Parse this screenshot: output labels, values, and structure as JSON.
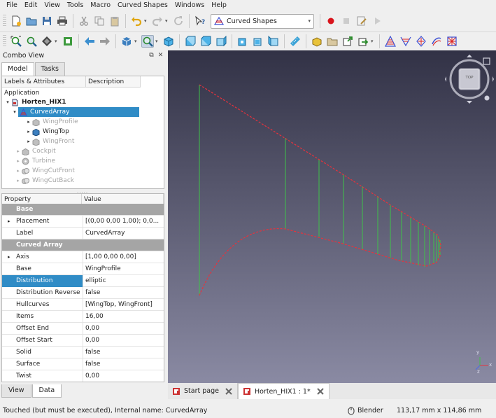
{
  "menu": [
    "File",
    "Edit",
    "View",
    "Tools",
    "Macro",
    "Curved Shapes",
    "Windows",
    "Help"
  ],
  "workbench": {
    "selected": "Curved Shapes"
  },
  "combo_view": {
    "title": "Combo View",
    "tabs": [
      "Model",
      "Tasks"
    ],
    "bottom_tabs": [
      "View",
      "Data"
    ]
  },
  "tree": {
    "headers": [
      "Labels & Attributes",
      "Description"
    ],
    "root": "Application",
    "items": [
      {
        "label": "Horten_HIX1",
        "bold": true,
        "icon": "document-icon"
      },
      {
        "label": "CurvedArray",
        "selected": true,
        "icon": "curved-array-icon"
      },
      {
        "label": "WingProfile",
        "dim": true,
        "icon": "part-icon"
      },
      {
        "label": "WingTop",
        "dim": false,
        "icon": "part-icon"
      },
      {
        "label": "WingFront",
        "dim": true,
        "icon": "part-icon"
      },
      {
        "label": "Cockpit",
        "dim": true,
        "icon": "part-icon"
      },
      {
        "label": "Turbine",
        "dim": true,
        "icon": "turbine-icon"
      },
      {
        "label": "WingCutFront",
        "dim": true,
        "icon": "cut-icon"
      },
      {
        "label": "WingCutBack",
        "dim": true,
        "icon": "cut-icon"
      }
    ]
  },
  "properties": {
    "headers": [
      "Property",
      "Value"
    ],
    "groups": [
      {
        "name": "Base"
      },
      {
        "name": "Curved Array"
      }
    ],
    "rows": [
      {
        "name": "Placement",
        "value": "[(0,00 0,00 1,00); 0,0..."
      },
      {
        "name": "Label",
        "value": "CurvedArray"
      },
      {
        "name": "Axis",
        "value": "[1,00 0,00 0,00]"
      },
      {
        "name": "Base",
        "value": "WingProfile"
      },
      {
        "name": "Distribution",
        "value": "elliptic"
      },
      {
        "name": "Distribution Reverse",
        "value": "false"
      },
      {
        "name": "Hullcurves",
        "value": "[WingTop, WingFront]"
      },
      {
        "name": "Items",
        "value": "16,00"
      },
      {
        "name": "Offset End",
        "value": "0,00"
      },
      {
        "name": "Offset Start",
        "value": "0,00"
      },
      {
        "name": "Solid",
        "value": "false"
      },
      {
        "name": "Surface",
        "value": "false"
      },
      {
        "name": "Twist",
        "value": "0,00"
      }
    ]
  },
  "navcube": {
    "face_label": "TOP"
  },
  "axis_labels": {
    "x": "x",
    "y": "y",
    "z": "z"
  },
  "doc_tabs": [
    {
      "label": "Start page",
      "active": false
    },
    {
      "label": "Horten_HIX1 : 1*",
      "active": true
    }
  ],
  "status": {
    "message": "Touched (but must be executed), Internal name: CurvedArray",
    "nav_style": "Blender",
    "dimensions": "113,17 mm x 114,86 mm"
  },
  "colors": {
    "selection": "#308cc6",
    "group_header": "#a5a5a5",
    "curve_red": "#e8323c",
    "rib_green": "#3fc24a",
    "view_top": "#323246",
    "view_bottom": "#8a8aa3"
  }
}
